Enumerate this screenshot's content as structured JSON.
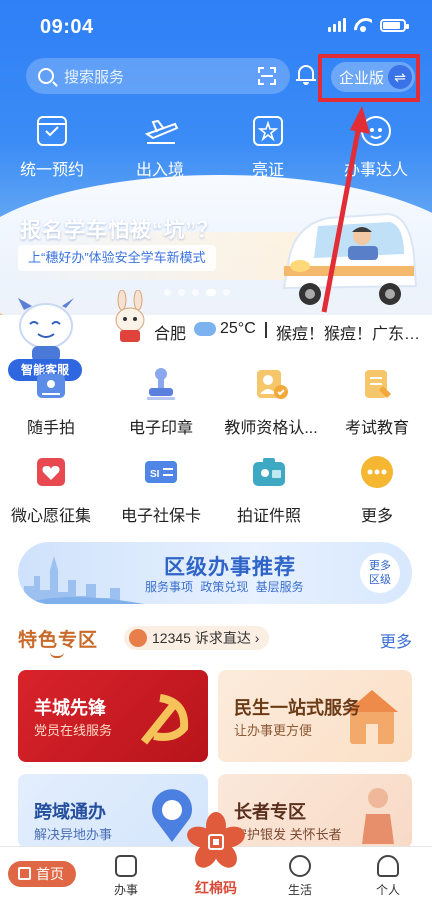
{
  "status": {
    "time": "09:04"
  },
  "search": {
    "placeholder": "搜索服务"
  },
  "enterprise_toggle": {
    "label": "企业版",
    "icon": "swap-icon"
  },
  "quick_actions": [
    {
      "label": "统一预约",
      "icon": "calendar-icon"
    },
    {
      "label": "出入境",
      "icon": "airplane-icon"
    },
    {
      "label": "亮证",
      "icon": "certificate-icon"
    },
    {
      "label": "办事达人",
      "icon": "mascot-icon"
    }
  ],
  "banner": {
    "title": "报名学车怕被“坑”？",
    "subtitle": "上“穗好办”体验安全学车新模式",
    "slides": 5,
    "active_slide": 4
  },
  "weather": {
    "city": "合肥",
    "temperature": "25°C",
    "news": "猴痘！猴痘！广东…"
  },
  "assistant": {
    "label": "智能客服"
  },
  "services": [
    {
      "label": "随手拍",
      "icon": "camera-icon",
      "color": "#5b8de8"
    },
    {
      "label": "电子印章",
      "icon": "stamp-icon",
      "color": "#6d8fe0"
    },
    {
      "label": "教师资格认...",
      "icon": "teacher-icon",
      "color": "#f2b23b"
    },
    {
      "label": "考试教育",
      "icon": "exam-icon",
      "color": "#f2b23b"
    },
    {
      "label": "微心愿征集",
      "icon": "heart-icon",
      "color": "#e8484f"
    },
    {
      "label": "电子社保卡",
      "icon": "card-icon",
      "color": "#4f86e6"
    },
    {
      "label": "拍证件照",
      "icon": "photo-id-icon",
      "color": "#3fa9c4"
    },
    {
      "label": "更多",
      "icon": "more-icon",
      "color": "#f5b731"
    }
  ],
  "district": {
    "title": "区级办事推荐",
    "subtitle": "服务事项 政策兑现 基层服务",
    "more_line1": "更多",
    "more_line2": "区级"
  },
  "featured": {
    "title": "特色专区",
    "hotline": "12345 诉求直达",
    "more": "更多",
    "cards": [
      {
        "title": "羊城先锋",
        "subtitle": "党员在线服务"
      },
      {
        "title": "民生一站式服务",
        "subtitle": "让办事更方便"
      },
      {
        "title": "跨域通办",
        "subtitle": "解决异地办事"
      },
      {
        "title": "长者专区",
        "subtitle": "守护银发 关怀长者"
      }
    ]
  },
  "tabbar": {
    "home": "首页",
    "tasks": "办事",
    "center": "红棉码",
    "life": "生活",
    "profile": "个人"
  },
  "colors": {
    "primary": "#2f7ff7",
    "highlight": "#e22d36",
    "accent": "#e06745"
  }
}
